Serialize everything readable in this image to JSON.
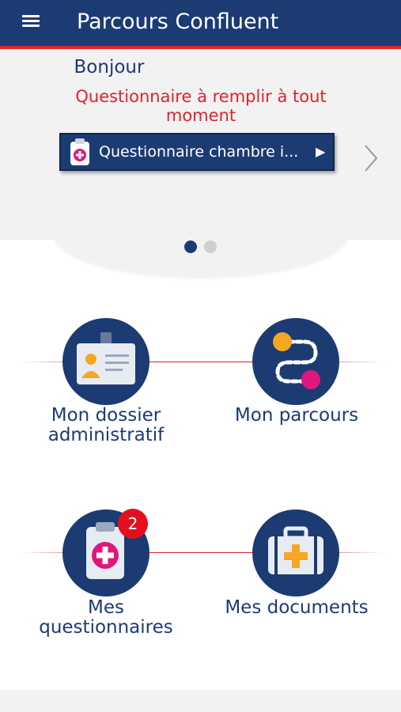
{
  "header": {
    "title": "Parcours Confluent",
    "menu_icon": "hamburger-menu-icon"
  },
  "carousel": {
    "greeting": "Bonjour",
    "subtitle": "Questionnaire à remplir à tout moment",
    "questionnaire_button": {
      "label": "Questionnaire chambre i...",
      "icon": "clipboard-cross-icon",
      "play_icon": "play-icon"
    },
    "next_icon": "chevron-right-icon",
    "page_count": 2,
    "active_page": 1
  },
  "tiles": [
    {
      "label_line1": "Mon dossier",
      "label_line2": "administratif",
      "icon": "id-card-icon"
    },
    {
      "label": "Mon parcours",
      "icon": "route-path-icon"
    },
    {
      "label_line1": "Mes",
      "label_line2": "questionnaires",
      "icon": "clipboard-cross-icon",
      "badge": "2"
    },
    {
      "label": "Mes documents",
      "icon": "medical-case-icon"
    }
  ],
  "colors": {
    "primary": "#1c3b73",
    "accent_red": "#e3202b",
    "pink": "#e0177a",
    "orange": "#f5a623",
    "background_grey": "#f2f2f2"
  }
}
